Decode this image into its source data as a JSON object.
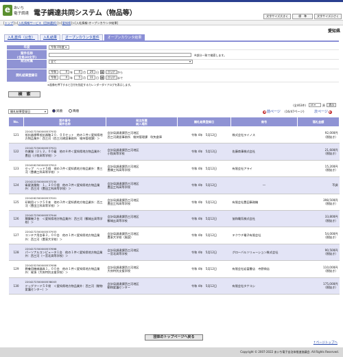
{
  "header": {
    "logo_mark": "e",
    "logo_line1": "あいち",
    "logo_line2": "電子調達",
    "system_title": "電子調達共同システム（物品等）",
    "btn_font_large": "文字サイズ大きく",
    "btn_standard": "標　準",
    "btn_font_small": "文字サイズ小さく"
  },
  "breadcrumb": {
    "items": [
      "トップ",
      "入札情報サービス（団体選択）",
      "愛知県",
      "入札情報-オープンカウンタ結果"
    ]
  },
  "region": "愛知県",
  "tabs": [
    "入札案件（公告）",
    "入札結果",
    "オープンカウンタ案件",
    "オープンカウンタ結果"
  ],
  "form": {
    "fiscal_year_label": "年度",
    "fiscal_year_value": "令和 4年度",
    "case_name_label": "案件名称",
    "case_name_sub": "(全角30文字)",
    "partial_match_note": "※部分一致で検索します。",
    "orderer_label": "発注所属",
    "orderer_value": "全て",
    "date_label": "開札結果登録日",
    "era_value": "令和",
    "from_year": "4",
    "from_month": "4",
    "from_day": "26",
    "to_year": "4",
    "to_month": "5",
    "to_day": "11",
    "year_unit": "年",
    "month_unit": "月",
    "day_unit": "日",
    "from_suffix": "から",
    "to_suffix": "まで",
    "clear_label": "クリア",
    "calendar_note": "※画像を押下すると日付を指定するカレンダーダイアログを表示します。"
  },
  "search_button": "検　索",
  "controls": {
    "sort_value": "開札結果登録日",
    "asc_label": "昇順",
    "desc_label": "降順",
    "total_count": "(全463件)",
    "page_value": "16",
    "page_unit": "頁",
    "go_label": "表示",
    "prev_label": "前ページ",
    "page_indicator": "(16/47ページ)",
    "next_label": "次ページ"
  },
  "table": {
    "headers": [
      "No.",
      "案件番号\n案件名称",
      "発注所属\n納入場所",
      "開札結果登録日",
      "商号",
      "落札金額"
    ],
    "rows": [
      {
        "no": "121",
        "num": "2204272300000537932",
        "name": "抵抗器標準抵抗器軸２０．００セット　他の１件＜愛知県地方物品業外：西三河（西三河建設事務所　維持管理課）＞",
        "orderer": "会計局調達課西三河地区",
        "place": "西三河建設事務所　維持管理課　吹矢倉庫",
        "date": "令和 4年　5月12日",
        "company": "株式会社ライノス",
        "amount": "92,000円",
        "tax": "（税抜き）"
      },
      {
        "no": "122",
        "num": "2204272300000537921",
        "name": "作業服（２Ｌ２，００着　他の８件＜愛知県地方物品業外：豊田（小牧高等学校）＞",
        "orderer": "会計局調達課西三河地区",
        "place": "小牧高等学校",
        "date": "令和 4年　5月12日",
        "company": "佐藤商事株式会社",
        "amount": "21,600円",
        "tax": "（税抜き）"
      },
      {
        "no": "123",
        "num": "2204262300000537912",
        "name": "セップ　ヘッド５個　他の３件＜愛知県地方物品業外：豊三河（豊橋工科高等学校）＞",
        "orderer": "会計局調達課西三河地区",
        "place": "豊橋工科高等学校",
        "date": "令和 4年　5月12日",
        "company": "有限会社アライ",
        "amount": "15,200円",
        "tax": "（税抜き）"
      },
      {
        "no": "124",
        "num": "2204222300000537230",
        "name": "衛星測量鈎　１，２００個　他の３件＜愛知県地方物品業外：西三河（豊田工科高等学校）＞",
        "orderer": "会計局調達課西三河地区",
        "place": "豊田工科高等学校",
        "date": "令和 4年　5月12日",
        "company": "―",
        "amount": "不調",
        "tax": ""
      },
      {
        "no": "125",
        "num": "2204262300000537001",
        "name": "印刷用インク５０本　他の３件＜愛知県地方物品業外：西三河（豊田工科高等学校）＞",
        "orderer": "会計局調達課西三河地区",
        "place": "豊田工科高等学校",
        "date": "令和 4年　5月12日",
        "company": "有限会社豊田事務機",
        "amount": "398,500円",
        "tax": "（税抜き）"
      },
      {
        "no": "126",
        "num": "2204272300000537944",
        "name": "積算機３台　＜愛知県地方物品業外：西三河（鶴城丘高等学校）＞",
        "orderer": "会計局調達課西三河地区",
        "place": "鶴城丘高等学校",
        "date": "令和 4年　5月12日",
        "company": "協和電気株式会社",
        "amount": "33,800円",
        "tax": "（税抜き）"
      },
      {
        "no": "127",
        "num": "2204272300000537933",
        "name": "コンテナ用台車３，００台　他の１件＜愛知県地方物品業外：西三河（豊東大学校）＞",
        "orderer": "会計局調達課西三河地区",
        "place": "豊東大学校（施設）",
        "date": "令和 4年　5月12日",
        "company": "テクウチ電子有限会社",
        "amount": "54,000円",
        "tax": "（税抜き）"
      },
      {
        "no": "128",
        "num": "2204272300000537698",
        "name": "パーソナルコンピュータ１台　他の１件＜愛知県地方物品業外：西三河（一宮北高等学校）＞",
        "orderer": "会計局調達課西三河地区",
        "place": "一宮北高等学校",
        "date": "令和 4年　5月12日",
        "company": "グローバルソリューション株式会社",
        "amount": "90,500円",
        "tax": "（税抜き）"
      },
      {
        "no": "129",
        "num": "2204252300000537658",
        "name": "教養用機械器具１，００台　他の１件＜愛知県地方物品業外：尾張（大府特別支援学校）＞",
        "orderer": "会計局調達課西三河地区",
        "place": "大府特別支援学校",
        "date": "令和 4年　5月12日",
        "company": "有限会社岩冨書店　寺野商店",
        "amount": "110,000円",
        "tax": "（税抜き）"
      },
      {
        "no": "130",
        "num": "2204272300000538003",
        "name": "ドッグフード５０袋　＜愛知県地方物品業外：西三河（動物愛護センター）＞",
        "orderer": "会計局調達課西三河地区",
        "place": "動物愛護センター",
        "date": "令和 4年　5月12日",
        "company": "有限会社タナコシ",
        "amount": "175,000円",
        "tax": "（税抜き）"
      }
    ]
  },
  "bottom_button": "団体のトップページへ戻る",
  "to_top": "ページトップへ",
  "footer": "Copyright © 2007-2022 あいち電子自治体推進協議会. All Rights Reserved."
}
